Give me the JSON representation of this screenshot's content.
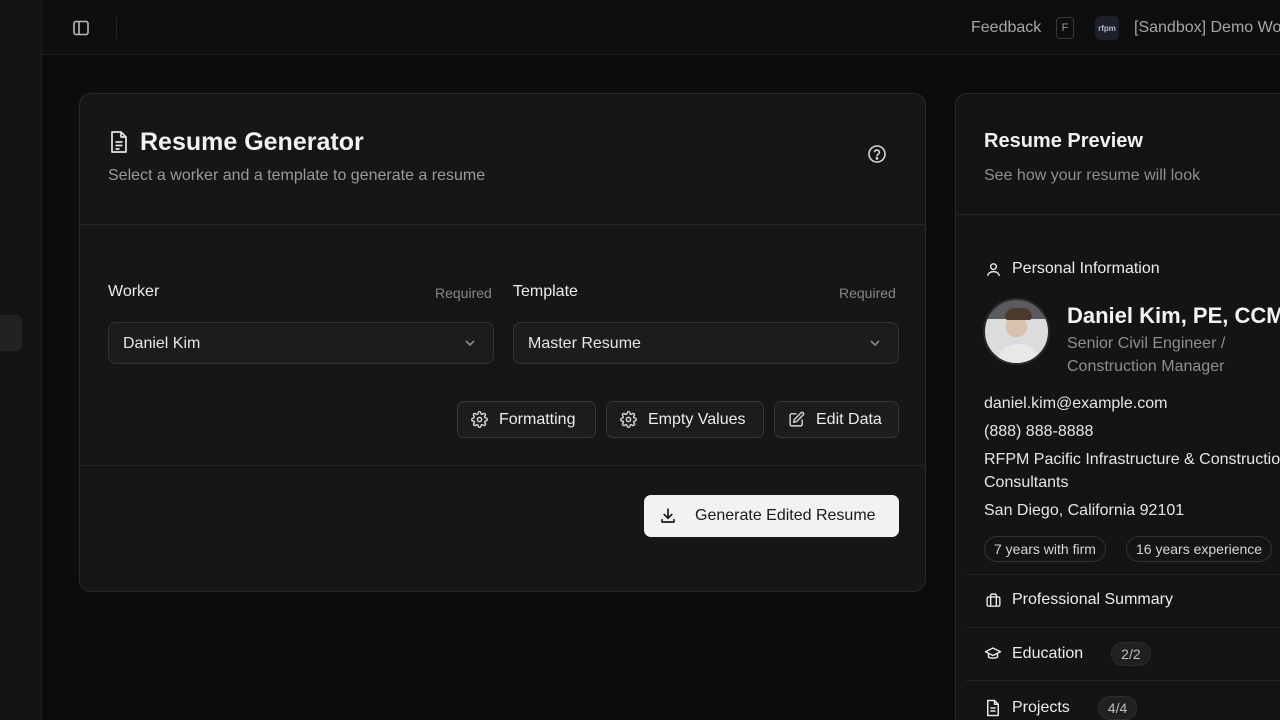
{
  "topbar": {
    "feedback_label": "Feedback",
    "feedback_shortcut": "F",
    "workspace_logo_text": "rfpm",
    "workspace_name": "[Sandbox] Demo Wo"
  },
  "generator": {
    "title": "Resume Generator",
    "subtitle": "Select a worker and a template to generate a resume",
    "worker": {
      "label": "Worker",
      "required": "Required",
      "value": "Daniel Kim"
    },
    "template": {
      "label": "Template",
      "required": "Required",
      "value": "Master Resume"
    },
    "buttons": {
      "formatting": "Formatting",
      "empty_values": "Empty Values",
      "edit_data": "Edit Data",
      "generate": "Generate Edited Resume"
    }
  },
  "preview": {
    "title": "Resume Preview",
    "subtitle": "See how your resume will look",
    "personal_info_label": "Personal Information",
    "name": "Daniel Kim, PE, CCM",
    "job_title": "Senior Civil Engineer / Construction Manager",
    "email": "daniel.kim@example.com",
    "phone": "(888) 888-8888",
    "company_line1": "RFPM Pacific Infrastructure & Construction",
    "company_line2": "Consultants",
    "location": "San Diego, California 92101",
    "tags": [
      "7 years with firm",
      "16 years experience"
    ],
    "sections": [
      {
        "label": "Professional Summary",
        "count": ""
      },
      {
        "label": "Education",
        "count": "2/2"
      },
      {
        "label": "Projects",
        "count": "4/4"
      }
    ]
  }
}
